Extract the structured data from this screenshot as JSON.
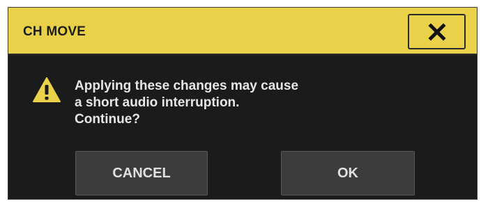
{
  "dialog": {
    "title": "CH MOVE",
    "close_icon": "close-icon",
    "warning_icon": "warning-icon",
    "message_lines": [
      "Applying these changes may cause",
      "a short audio interruption.",
      "Continue?"
    ],
    "cancel_label": "CANCEL",
    "ok_label": "OK"
  },
  "colors": {
    "titlebar": "#e9d24a",
    "body": "#1b1b1b",
    "button": "#3c3c3c",
    "text": "#e6e6e6",
    "warning": "#e9d24a"
  }
}
